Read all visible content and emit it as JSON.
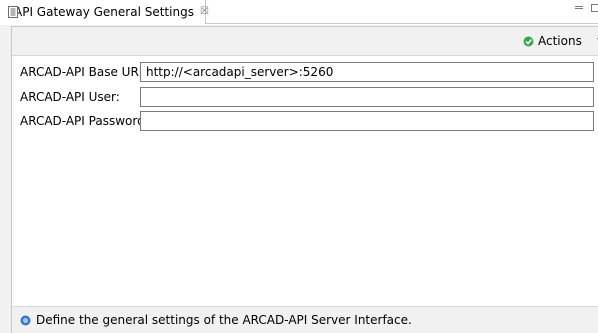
{
  "tab": {
    "title": "API Gateway General Settings",
    "close_glyph": "☒",
    "icon": "view-icon"
  },
  "toolbar": {
    "actions_label": "Actions",
    "actions_icon": "actions-icon"
  },
  "form": {
    "base_url_label": "ARCAD-API Base URL:",
    "base_url_value": "http://<arcadapi_server>:5260",
    "user_label": "ARCAD-API User:",
    "user_value": "",
    "password_label": "ARCAD-API Password:",
    "password_value": ""
  },
  "status": {
    "message": "Define the general settings of the ARCAD-API Server Interface.",
    "icon": "info-icon"
  },
  "colors": {
    "border": "#c8c8c8",
    "panel_bg": "#f1f1f1",
    "input_border": "#7a7a7a",
    "accent_green": "#3aa655",
    "info_blue": "#3b73c7"
  }
}
